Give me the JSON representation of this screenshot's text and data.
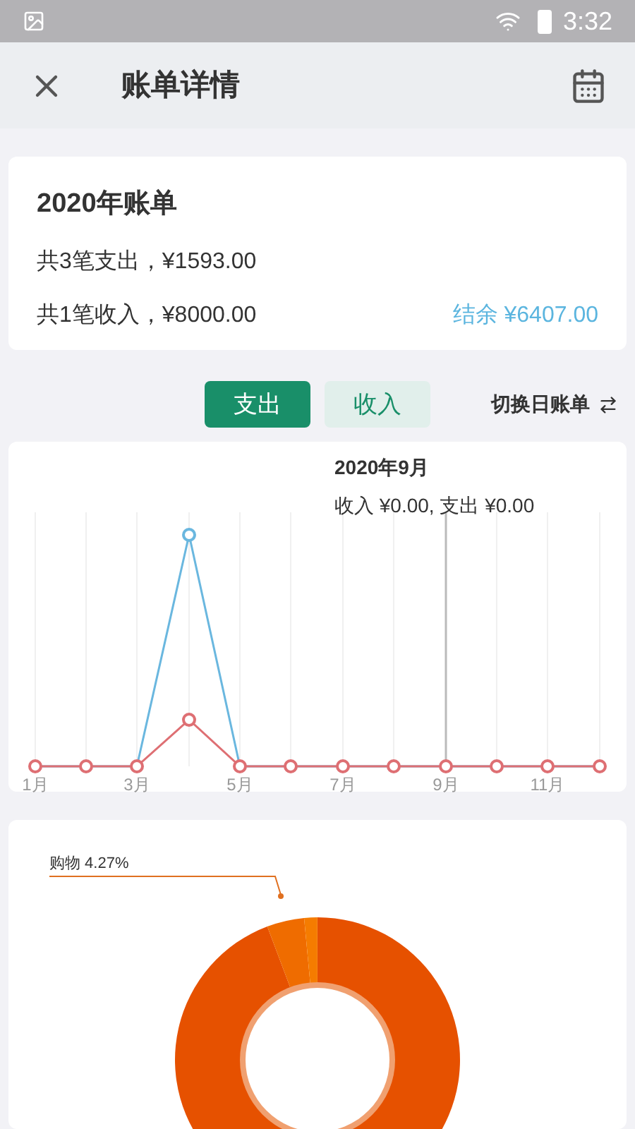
{
  "status_bar": {
    "time": "3:32"
  },
  "header": {
    "title": "账单详情"
  },
  "summary": {
    "title": "2020年账单",
    "expense_line": "共3笔支出，¥1593.00",
    "income_line": "共1笔收入，¥8000.00",
    "balance": "结余 ¥6407.00"
  },
  "toggle": {
    "tabs": [
      {
        "label": "支出",
        "selected": true
      },
      {
        "label": "收入",
        "selected": false
      }
    ],
    "switch_link": "切换日账单"
  },
  "line_chart": {
    "month_labels": [
      "1月",
      "3月",
      "5月",
      "7月",
      "9月",
      "11月"
    ],
    "tooltip": {
      "title": "2020年9月",
      "text": "收入 ¥0.00, 支出 ¥0.00"
    }
  },
  "donut": {
    "label": "购物 4.27%"
  }
}
